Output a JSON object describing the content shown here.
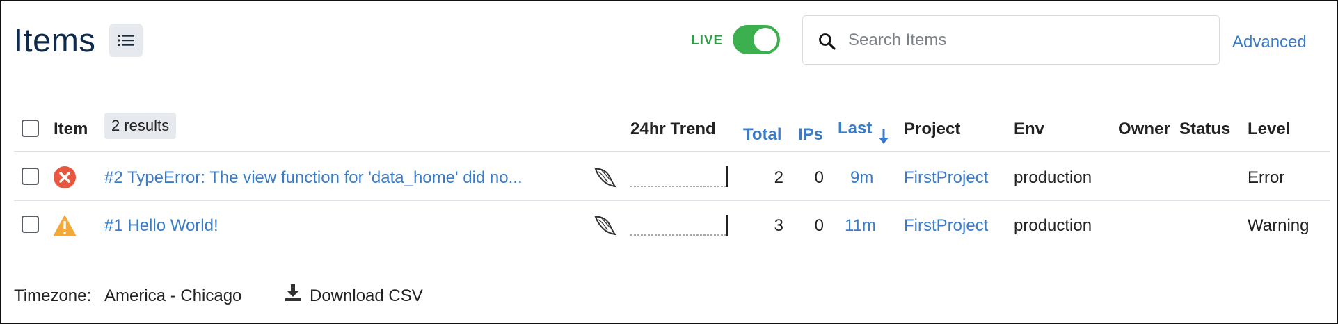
{
  "header": {
    "title": "Items",
    "live_label": "LIVE",
    "search_placeholder": "Search Items",
    "advanced_label": "Advanced"
  },
  "table": {
    "columns": {
      "item": "Item",
      "results": "2 results",
      "trend": "24hr Trend",
      "total": "Total",
      "ips": "IPs",
      "last": "Last",
      "project": "Project",
      "env": "Env",
      "owner": "Owner",
      "status": "Status",
      "level": "Level"
    },
    "rows": [
      {
        "title": "#2 TypeError: The view function for 'data_home' did no...",
        "level_icon": "error-x-icon",
        "framework_icon": "flask-icon",
        "total": "2",
        "ips": "0",
        "last": "9m",
        "project": "FirstProject",
        "env": "production",
        "owner": "",
        "status": "",
        "level": "Error"
      },
      {
        "title": "#1 Hello World!",
        "level_icon": "warning-icon",
        "framework_icon": "flask-icon",
        "total": "3",
        "ips": "0",
        "last": "11m",
        "project": "FirstProject",
        "env": "production",
        "owner": "",
        "status": "",
        "level": "Warning"
      }
    ]
  },
  "footer": {
    "timezone_label": "Timezone:",
    "timezone_value": "America - Chicago",
    "download_label": "Download CSV"
  },
  "colors": {
    "title": "#0e2a4d",
    "link": "#3a7cc8",
    "live_green": "#3cb04f",
    "error_red": "#e8573f",
    "warning_orange": "#f3a93a"
  }
}
